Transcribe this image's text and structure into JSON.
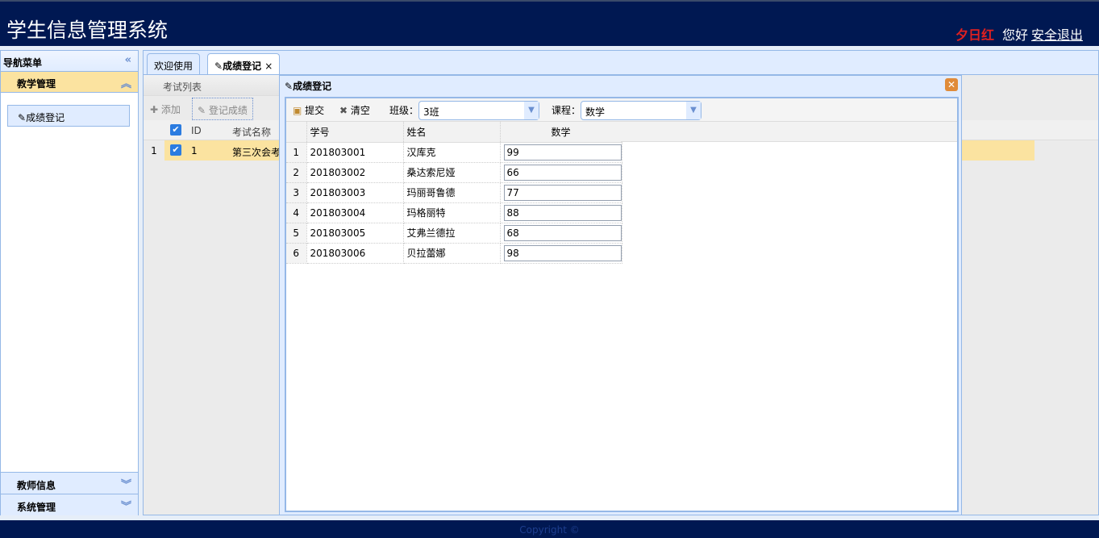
{
  "header": {
    "title": "学生信息管理系统",
    "user": "夕日红",
    "greeting": "您好",
    "logout": "安全退出"
  },
  "nav": {
    "title": "导航菜单",
    "groups": [
      {
        "label": "教学管理",
        "items": [
          "成绩登记"
        ]
      },
      {
        "label": "教师信息"
      },
      {
        "label": "系统管理"
      }
    ]
  },
  "tabs": [
    {
      "label": "欢迎使用"
    },
    {
      "label": "成绩登记",
      "close": "×"
    }
  ],
  "exam_list": {
    "title": "考试列表",
    "toolbar": [
      "添加",
      "登记成绩"
    ],
    "columns": [
      "ID",
      "考试名称"
    ],
    "rows": [
      {
        "num": "1",
        "id": "1",
        "name": "第三次会考"
      }
    ]
  },
  "dialog": {
    "title": "成绩登记",
    "toolbar": {
      "submit": "提交",
      "clear": "清空",
      "class_label": "班级：",
      "class_value": "3班",
      "course_label": "课程：",
      "course_value": "数学"
    },
    "columns": [
      "学号",
      "姓名",
      "数学"
    ],
    "rows": [
      {
        "n": "1",
        "id": "201803001",
        "name": "汉库克",
        "score": "99"
      },
      {
        "n": "2",
        "id": "201803002",
        "name": "桑达索尼娅",
        "score": "66"
      },
      {
        "n": "3",
        "id": "201803003",
        "name": "玛丽哥鲁德",
        "score": "77"
      },
      {
        "n": "4",
        "id": "201803004",
        "name": "玛格丽特",
        "score": "88"
      },
      {
        "n": "5",
        "id": "201803005",
        "name": "艾弗兰德拉",
        "score": "68"
      },
      {
        "n": "6",
        "id": "201803006",
        "name": "贝拉蕾娜",
        "score": "98"
      }
    ]
  },
  "footer": {
    "copyright": "Copyright ©"
  }
}
